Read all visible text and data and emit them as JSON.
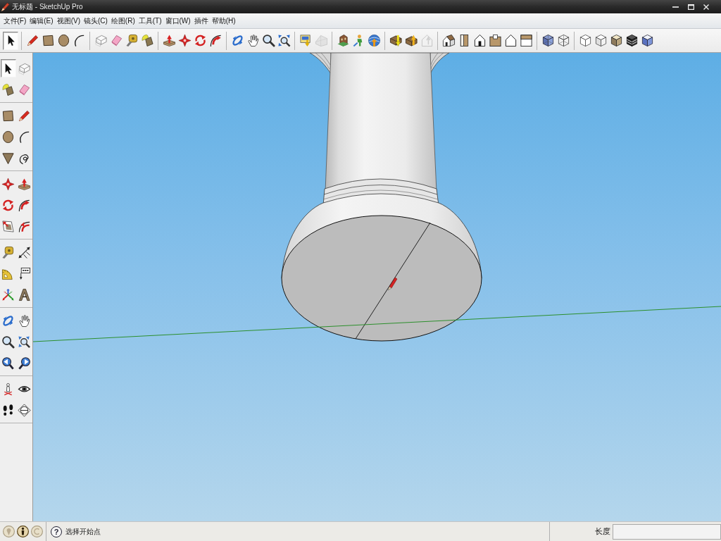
{
  "window": {
    "title": "无标题 - SketchUp Pro"
  },
  "menu_bar": {
    "items": [
      "文件(F)",
      "编辑(E)",
      "视图(V)",
      "镜头(C)",
      "绘图(R)",
      "工具(T)",
      "窗口(W)",
      "插件",
      "帮助(H)"
    ]
  },
  "top_toolbar": {
    "groups": [
      {
        "tools": [
          {
            "selected": true,
            "disabled": false
          }
        ]
      },
      {
        "tools": [
          {
            "selected": false,
            "disabled": false
          },
          {
            "selected": false,
            "disabled": false
          },
          {
            "selected": false,
            "disabled": false
          },
          {
            "selected": false,
            "disabled": false
          }
        ]
      },
      {
        "tools": [
          {
            "selected": false,
            "disabled": false
          },
          {
            "selected": false,
            "disabled": false
          },
          {
            "selected": false,
            "disabled": false
          },
          {
            "selected": false,
            "disabled": false
          }
        ]
      },
      {
        "tools": [
          {
            "selected": false,
            "disabled": false
          },
          {
            "selected": false,
            "disabled": false
          },
          {
            "selected": false,
            "disabled": false
          },
          {
            "selected": false,
            "disabled": false
          }
        ]
      },
      {
        "tools": [
          {
            "selected": false,
            "disabled": false
          },
          {
            "selected": false,
            "disabled": false
          },
          {
            "selected": false,
            "disabled": false
          },
          {
            "selected": false,
            "disabled": false
          }
        ]
      },
      {
        "tools": [
          {
            "selected": false,
            "disabled": false
          },
          {
            "selected": false,
            "disabled": true
          }
        ]
      },
      {
        "tools": [
          {
            "selected": false,
            "disabled": false
          },
          {
            "selected": false,
            "disabled": false
          },
          {
            "selected": false,
            "disabled": false
          }
        ]
      },
      {
        "tools": [
          {
            "selected": false,
            "disabled": false
          },
          {
            "selected": false,
            "disabled": false
          },
          {
            "selected": false,
            "disabled": true
          }
        ]
      },
      {
        "tools": [
          {
            "selected": false,
            "disabled": false
          },
          {
            "selected": false,
            "disabled": false
          },
          {
            "selected": false,
            "disabled": false
          },
          {
            "selected": false,
            "disabled": false
          },
          {
            "selected": false,
            "disabled": false
          },
          {
            "selected": false,
            "disabled": false
          }
        ]
      },
      {
        "tools": [
          {
            "selected": false,
            "disabled": false
          },
          {
            "selected": false,
            "disabled": false
          }
        ]
      },
      {
        "tools": [
          {
            "selected": false,
            "disabled": false
          },
          {
            "selected": false,
            "disabled": false
          },
          {
            "selected": false,
            "disabled": false
          },
          {
            "selected": false,
            "disabled": false
          },
          {
            "selected": false,
            "disabled": false
          }
        ]
      }
    ]
  },
  "left_toolbar": {
    "groups": [
      {
        "tools": [
          {
            "selected": true
          },
          {
            "selected": false
          },
          {
            "selected": false
          },
          {
            "selected": false
          }
        ]
      },
      {
        "tools": [
          {
            "selected": false
          },
          {
            "selected": false
          },
          {
            "selected": false
          },
          {
            "selected": false
          },
          {
            "selected": false
          },
          {
            "selected": false
          }
        ]
      },
      {
        "tools": [
          {
            "selected": false
          },
          {
            "selected": false
          },
          {
            "selected": false
          },
          {
            "selected": false
          },
          {
            "selected": false
          },
          {
            "selected": false
          }
        ]
      },
      {
        "tools": [
          {
            "selected": false
          },
          {
            "selected": false
          },
          {
            "selected": false
          },
          {
            "selected": false
          },
          {
            "selected": false
          },
          {
            "selected": false
          }
        ]
      },
      {
        "tools": [
          {
            "selected": false
          },
          {
            "selected": false
          },
          {
            "selected": false
          },
          {
            "selected": false
          },
          {
            "selected": false
          },
          {
            "selected": false
          }
        ]
      },
      {
        "tools": [
          {
            "selected": false
          },
          {
            "selected": false
          },
          {
            "selected": false
          },
          {
            "selected": false
          }
        ]
      }
    ]
  },
  "status_bar": {
    "status_icons": [
      {
        "disabled": true
      },
      {
        "disabled": false
      },
      {
        "disabled": true
      }
    ],
    "help": "?",
    "hint": "选择开始点",
    "measurement_label": "长度"
  }
}
